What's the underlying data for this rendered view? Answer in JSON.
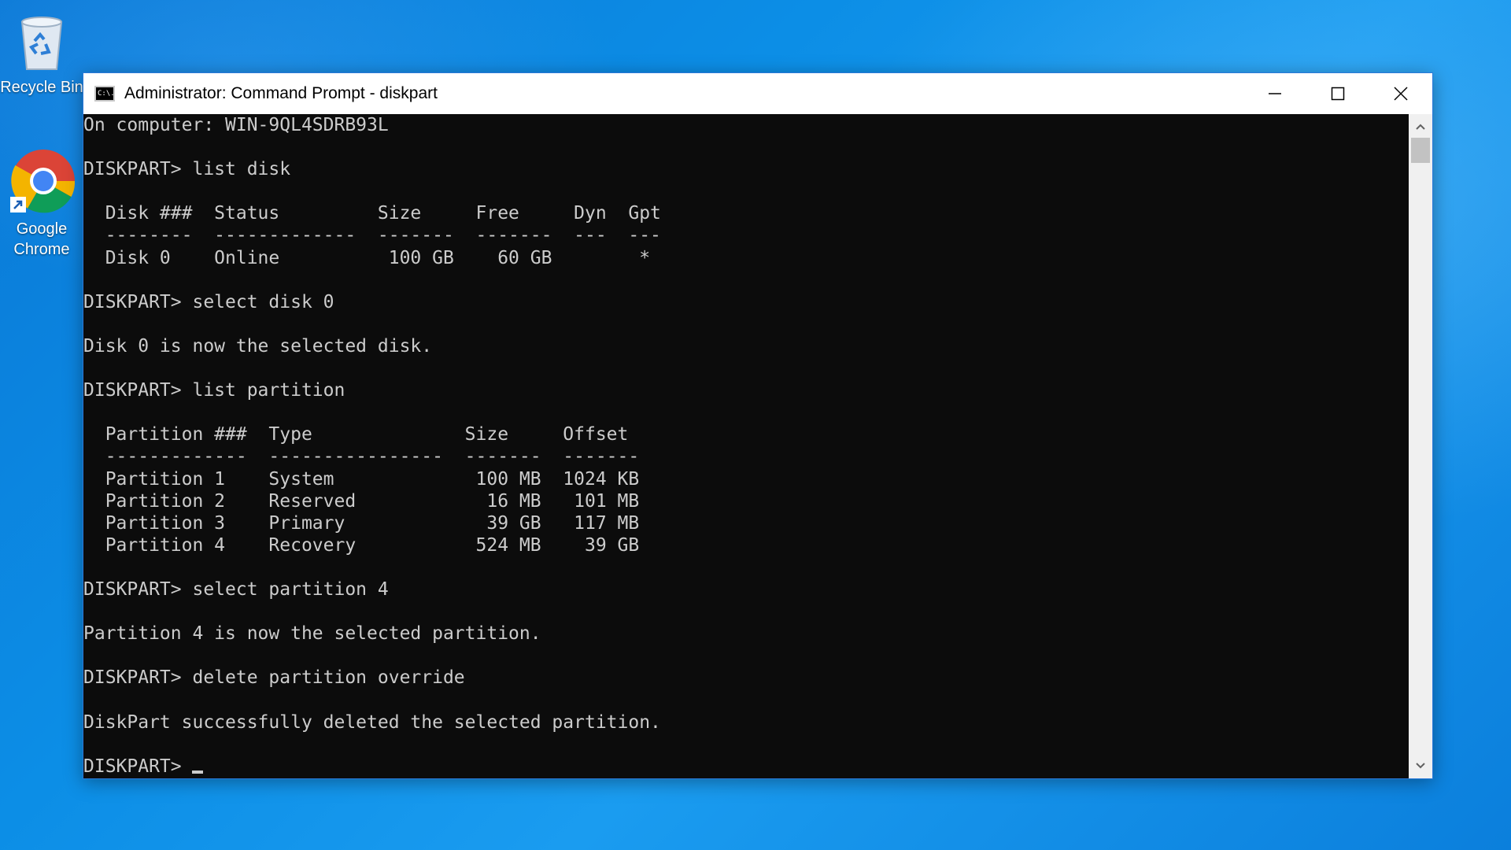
{
  "desktop": {
    "icons": [
      {
        "label": "Recycle Bin",
        "icon": "recycle-bin-icon"
      },
      {
        "label": "Google\nChrome",
        "icon": "chrome-icon"
      }
    ]
  },
  "window": {
    "title": "Administrator: Command Prompt - diskpart",
    "icon_label": "C:\\.",
    "controls": {
      "minimize": "minimize-icon",
      "maximize": "maximize-icon",
      "close": "close-icon"
    }
  },
  "console": {
    "lines": [
      "On computer: WIN-9QL4SDRB93L",
      "",
      "DISKPART> list disk",
      "",
      "  Disk ###  Status         Size     Free     Dyn  Gpt",
      "  --------  -------------  -------  -------  ---  ---",
      "  Disk 0    Online          100 GB    60 GB        *",
      "",
      "DISKPART> select disk 0",
      "",
      "Disk 0 is now the selected disk.",
      "",
      "DISKPART> list partition",
      "",
      "  Partition ###  Type              Size     Offset",
      "  -------------  ----------------  -------  -------",
      "  Partition 1    System             100 MB  1024 KB",
      "  Partition 2    Reserved            16 MB   101 MB",
      "  Partition 3    Primary             39 GB   117 MB",
      "  Partition 4    Recovery           524 MB    39 GB",
      "",
      "DISKPART> select partition 4",
      "",
      "Partition 4 is now the selected partition.",
      "",
      "DISKPART> delete partition override",
      "",
      "DiskPart successfully deleted the selected partition.",
      ""
    ],
    "prompt": "DISKPART> "
  },
  "colors": {
    "console_bg": "#0c0c0c",
    "console_text": "#cccccc",
    "titlebar_bg": "#ffffff",
    "desktop_accent": "#0c8ee6"
  }
}
